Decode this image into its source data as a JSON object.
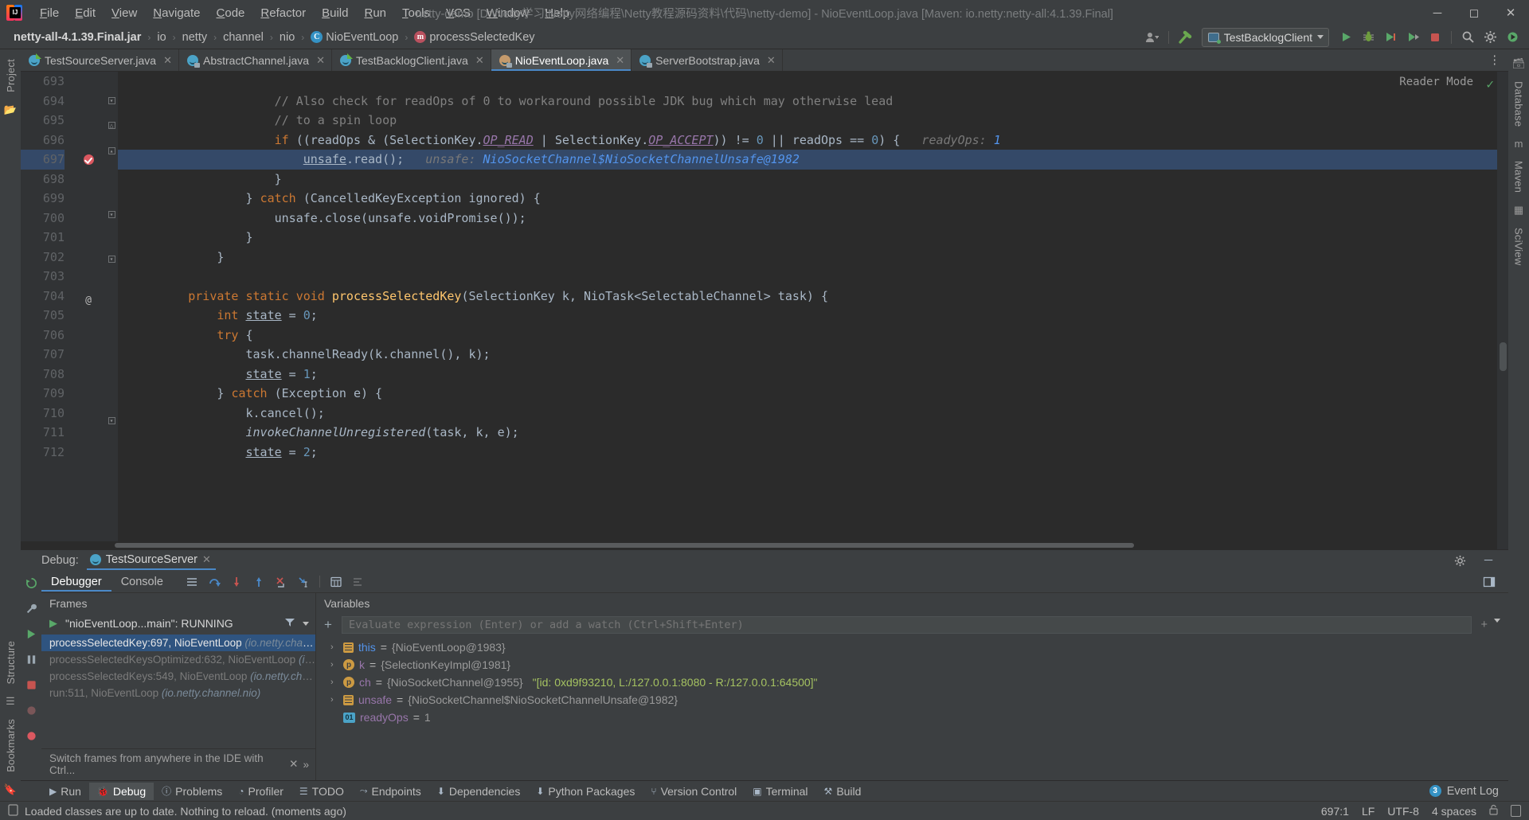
{
  "titlebar": {
    "logo": "intellij-idea-logo",
    "menus": [
      "File",
      "Edit",
      "View",
      "Navigate",
      "Code",
      "Refactor",
      "Build",
      "Run",
      "Tools",
      "VCS",
      "Window",
      "Help"
    ],
    "window_title": "netty-demo [D:\\Netty学习\\Netty网络编程\\Netty教程源码资料\\代码\\netty-demo] - NioEventLoop.java [Maven: io.netty:netty-all:4.1.39.Final]",
    "minimize": "─",
    "maximize": "☐",
    "close": "✕"
  },
  "navbar": {
    "crumbs": [
      {
        "label": "netty-all-4.1.39.Final.jar",
        "icon": "jar-icon",
        "bold": true
      },
      {
        "label": "io",
        "icon": "package-icon",
        "bold": false
      },
      {
        "label": "netty",
        "icon": "package-icon",
        "bold": false
      },
      {
        "label": "channel",
        "icon": "package-icon",
        "bold": false
      },
      {
        "label": "nio",
        "icon": "package-icon",
        "bold": false
      },
      {
        "label": "NioEventLoop",
        "icon": "class-icon",
        "bold": false
      },
      {
        "label": "processSelectedKey",
        "icon": "method-icon",
        "bold": false
      }
    ],
    "separator": "›",
    "class_badge": "C",
    "method_badge": "m",
    "run_config": "TestBacklogClient",
    "icons": [
      "user-avatar-icon",
      "chevron-down-icon",
      "hammer-build-icon",
      "run-icon",
      "debug-icon",
      "run-coverage-icon",
      "profiler-icon",
      "stop-icon",
      "search-icon",
      "settings-gear-icon",
      "updates-icon"
    ]
  },
  "editor_tabs": [
    {
      "label": "TestSourceServer.java",
      "icon": "java-run-class-icon",
      "active": false
    },
    {
      "label": "AbstractChannel.java",
      "icon": "java-lib-class-icon",
      "active": false
    },
    {
      "label": "TestBacklogClient.java",
      "icon": "java-run-class-icon",
      "active": false
    },
    {
      "label": "NioEventLoop.java",
      "icon": "java-lib-class-icon",
      "active": true
    },
    {
      "label": "ServerBootstrap.java",
      "icon": "java-lib-class-icon",
      "active": false
    }
  ],
  "editor": {
    "reader_mode": "Reader Mode",
    "reader_check": "✓",
    "first_line": 693,
    "lines": [
      {
        "n": 693,
        "fold": "",
        "mark": "",
        "hl": false,
        "tokens": []
      },
      {
        "n": 694,
        "fold": "end",
        "mark": "",
        "hl": false,
        "tokens": [
          {
            "t": "                    ",
            "c": "def"
          },
          {
            "t": "// Also check for readOps of 0 to workaround possible JDK bug which may otherwise lead",
            "c": "cmt"
          }
        ]
      },
      {
        "n": 695,
        "fold": "mid",
        "mark": "",
        "hl": false,
        "tokens": [
          {
            "t": "                    ",
            "c": "def"
          },
          {
            "t": "// to a spin loop",
            "c": "cmt"
          }
        ]
      },
      {
        "n": 696,
        "fold": "start",
        "mark": "",
        "hl": false,
        "tokens": [
          {
            "t": "                    ",
            "c": "def"
          },
          {
            "t": "if",
            "c": "kw"
          },
          {
            "t": " ((readOps & (SelectionKey.",
            "c": "def"
          },
          {
            "t": "OP_READ",
            "c": "sfld"
          },
          {
            "t": " | SelectionKey.",
            "c": "def"
          },
          {
            "t": "OP_ACCEPT",
            "c": "sfld"
          },
          {
            "t": ")) != ",
            "c": "def"
          },
          {
            "t": "0",
            "c": "num"
          },
          {
            "t": " || readOps == ",
            "c": "def"
          },
          {
            "t": "0",
            "c": "num"
          },
          {
            "t": ") {",
            "c": "def"
          },
          {
            "t": "   readyOps: ",
            "c": "hint"
          },
          {
            "t": "1",
            "c": "hintv"
          }
        ]
      },
      {
        "n": 697,
        "fold": "",
        "mark": "breakpoint-verified",
        "hl": true,
        "tokens": [
          {
            "t": "                        ",
            "c": "def"
          },
          {
            "t": "unsafe",
            "c": "stm"
          },
          {
            "t": ".read();",
            "c": "def"
          },
          {
            "t": "   unsafe: ",
            "c": "hint"
          },
          {
            "t": "NioSocketChannel$NioSocketChannelUnsafe@1982",
            "c": "hintv"
          }
        ]
      },
      {
        "n": 698,
        "fold": "",
        "mark": "",
        "hl": false,
        "tokens": [
          {
            "t": "                    }",
            "c": "def"
          }
        ]
      },
      {
        "n": 699,
        "fold": "end",
        "mark": "",
        "hl": false,
        "tokens": [
          {
            "t": "                ",
            "c": "def"
          },
          {
            "t": "} ",
            "c": "def"
          },
          {
            "t": "catch",
            "c": "kw"
          },
          {
            "t": " (CancelledKeyException ignored) {",
            "c": "def"
          }
        ]
      },
      {
        "n": 700,
        "fold": "",
        "mark": "",
        "hl": false,
        "tokens": [
          {
            "t": "                    unsafe.close(unsafe.voidPromise());",
            "c": "def"
          }
        ]
      },
      {
        "n": 701,
        "fold": "end",
        "mark": "",
        "hl": false,
        "tokens": [
          {
            "t": "                }",
            "c": "def"
          }
        ]
      },
      {
        "n": 702,
        "fold": "",
        "mark": "",
        "hl": false,
        "tokens": [
          {
            "t": "            }",
            "c": "def"
          }
        ]
      },
      {
        "n": 703,
        "fold": "",
        "mark": "",
        "hl": false,
        "tokens": []
      },
      {
        "n": 704,
        "fold": "",
        "mark": "override",
        "hl": false,
        "tokens": [
          {
            "t": "        ",
            "c": "def"
          },
          {
            "t": "private static void",
            "c": "kw"
          },
          {
            "t": " ",
            "c": "def"
          },
          {
            "t": "processSelectedKey",
            "c": "mth"
          },
          {
            "t": "(SelectionKey k, NioTask<SelectableChannel> task) {",
            "c": "def"
          }
        ]
      },
      {
        "n": 705,
        "fold": "",
        "mark": "",
        "hl": false,
        "tokens": [
          {
            "t": "            ",
            "c": "def"
          },
          {
            "t": "int",
            "c": "kw"
          },
          {
            "t": " ",
            "c": "def"
          },
          {
            "t": "state",
            "c": "stm"
          },
          {
            "t": " = ",
            "c": "def"
          },
          {
            "t": "0",
            "c": "num"
          },
          {
            "t": ";",
            "c": "def"
          }
        ]
      },
      {
        "n": 706,
        "fold": "",
        "mark": "",
        "hl": false,
        "tokens": [
          {
            "t": "            ",
            "c": "def"
          },
          {
            "t": "try",
            "c": "kw"
          },
          {
            "t": " {",
            "c": "def"
          }
        ]
      },
      {
        "n": 707,
        "fold": "",
        "mark": "",
        "hl": false,
        "tokens": [
          {
            "t": "                task.channelReady(k.channel(), k);",
            "c": "def"
          }
        ]
      },
      {
        "n": 708,
        "fold": "",
        "mark": "",
        "hl": false,
        "tokens": [
          {
            "t": "                ",
            "c": "def"
          },
          {
            "t": "state",
            "c": "stm"
          },
          {
            "t": " = ",
            "c": "def"
          },
          {
            "t": "1",
            "c": "num"
          },
          {
            "t": ";",
            "c": "def"
          }
        ]
      },
      {
        "n": 709,
        "fold": "end",
        "mark": "",
        "hl": false,
        "tokens": [
          {
            "t": "            ",
            "c": "def"
          },
          {
            "t": "} ",
            "c": "def"
          },
          {
            "t": "catch",
            "c": "kw"
          },
          {
            "t": " (Exception e) {",
            "c": "def"
          }
        ]
      },
      {
        "n": 710,
        "fold": "",
        "mark": "",
        "hl": false,
        "tokens": [
          {
            "t": "                k.cancel();",
            "c": "def"
          }
        ]
      },
      {
        "n": 711,
        "fold": "",
        "mark": "",
        "hl": false,
        "tokens": [
          {
            "t": "                ",
            "c": "def"
          },
          {
            "t": "invokeChannelUnregistered",
            "c": "itl"
          },
          {
            "t": "(task, k, e);",
            "c": "def"
          }
        ]
      },
      {
        "n": 712,
        "fold": "",
        "mark": "",
        "hl": false,
        "tokens": [
          {
            "t": "                ",
            "c": "def"
          },
          {
            "t": "state",
            "c": "stm"
          },
          {
            "t": " = ",
            "c": "def"
          },
          {
            "t": "2",
            "c": "num"
          },
          {
            "t": ";",
            "c": "def"
          }
        ]
      }
    ]
  },
  "debug": {
    "label": "Debug:",
    "session": "TestSourceServer",
    "session_close": "✕",
    "tabs": [
      {
        "label": "Debugger",
        "active": true
      },
      {
        "label": "Console",
        "active": false
      }
    ],
    "toolbar_icons": [
      "show-frames-icon",
      "step-over-icon",
      "step-into-icon",
      "force-step-into-icon",
      "step-out-icon",
      "drop-frame-icon",
      "run-to-cursor-icon",
      "evaluate-expression-icon",
      "settings-layout-icon"
    ],
    "side_icons": [
      "rerun-icon",
      "wrench-settings-icon",
      "resume-program-icon",
      "pause-program-icon",
      "stop-icon",
      "mute-breakpoints-icon",
      "view-breakpoints-icon"
    ],
    "frames": {
      "title": "Frames",
      "thread": "\"nioEventLoop...main\": RUNNING",
      "filter_icon": "filter-icon",
      "dropdown_icon": "chevron-down-icon",
      "items": [
        {
          "method": "processSelectedKey:697, NioEventLoop",
          "pkg": "(io.netty.channel.nio)",
          "selected": true
        },
        {
          "method": "processSelectedKeysOptimized:632, NioEventLoop",
          "pkg": "(io.netty.channel.nio)",
          "selected": false
        },
        {
          "method": "processSelectedKeys:549, NioEventLoop",
          "pkg": "(io.netty.channel.nio)",
          "selected": false
        },
        {
          "method": "run:511, NioEventLoop",
          "pkg": "(io.netty.channel.nio)",
          "selected": false
        }
      ],
      "footer": "Switch frames from anywhere in the IDE with Ctrl...",
      "footer_close": "✕",
      "expand": "»"
    },
    "variables": {
      "title": "Variables",
      "eval_placeholder": "Evaluate expression (Enter) or add a watch (Ctrl+Shift+Enter)",
      "add_icon": "+",
      "items": [
        {
          "expand": "›",
          "icon": "object-field-icon",
          "name": "this",
          "name_color": "blue",
          "eq": " = ",
          "value": "{NioEventLoop@1983}",
          "str": ""
        },
        {
          "expand": "›",
          "icon": "parameter-icon",
          "name": "k",
          "name_color": "purple",
          "eq": " = ",
          "value": "{SelectionKeyImpl@1981}",
          "str": ""
        },
        {
          "expand": "›",
          "icon": "parameter-icon",
          "name": "ch",
          "name_color": "purple",
          "eq": " = ",
          "value": "{NioSocketChannel@1955}",
          "str": "\"[id: 0xd9f93210, L:/127.0.0.1:8080 - R:/127.0.0.1:64500]\""
        },
        {
          "expand": "›",
          "icon": "object-field-icon",
          "name": "unsafe",
          "name_color": "purple",
          "eq": " = ",
          "value": "{NioSocketChannel$NioSocketChannelUnsafe@1982}",
          "str": ""
        },
        {
          "expand": "",
          "icon": "primitive-icon",
          "name": "readyOps",
          "name_color": "purple",
          "eq": " = ",
          "value": "1",
          "str": ""
        }
      ],
      "primitive_badge": "01",
      "param_badge": "p"
    },
    "settings_icon": "gear-icon",
    "minimize_icon": "─"
  },
  "left_strips": [
    {
      "label": "Project",
      "icon": "project-icon"
    },
    {
      "label": "Structure",
      "icon": "structure-icon"
    },
    {
      "label": "Bookmarks",
      "icon": "bookmarks-icon"
    }
  ],
  "right_strips": [
    {
      "label": "Database",
      "icon": "database-icon"
    },
    {
      "label": "Maven",
      "icon": "maven-icon"
    },
    {
      "label": "SciView",
      "icon": "sciview-icon"
    }
  ],
  "toolwindows": [
    {
      "label": "Run",
      "icon": "run-icon",
      "active": false
    },
    {
      "label": "Debug",
      "icon": "debug-icon",
      "active": true
    },
    {
      "label": "Problems",
      "icon": "problems-icon",
      "active": false
    },
    {
      "label": "Profiler",
      "icon": "profiler-icon",
      "active": false
    },
    {
      "label": "TODO",
      "icon": "todo-icon",
      "active": false
    },
    {
      "label": "Endpoints",
      "icon": "endpoints-icon",
      "active": false
    },
    {
      "label": "Dependencies",
      "icon": "dependencies-icon",
      "active": false
    },
    {
      "label": "Python Packages",
      "icon": "python-packages-icon",
      "active": false
    },
    {
      "label": "Version Control",
      "icon": "version-control-icon",
      "active": false
    },
    {
      "label": "Terminal",
      "icon": "terminal-icon",
      "active": false
    },
    {
      "label": "Build",
      "icon": "build-icon",
      "active": false
    }
  ],
  "event_log": {
    "label": "Event Log",
    "count": "3"
  },
  "status": {
    "message": "Loaded classes are up to date. Nothing to reload. (moments ago)",
    "message_icon": "notification-icon",
    "position": "697:1",
    "line_sep": "LF",
    "encoding": "UTF-8",
    "indent": "4 spaces",
    "lock_icon": "unlocked-icon",
    "memory_icon": "memory-indicator"
  },
  "colors": {
    "accent": "#4a88c7",
    "editor_bg": "#2b2b2b",
    "chrome_bg": "#3c3f41",
    "selection": "#344968",
    "frame_selected": "#2f5480",
    "breakpoint": "#db5860",
    "green": "#59a869"
  }
}
